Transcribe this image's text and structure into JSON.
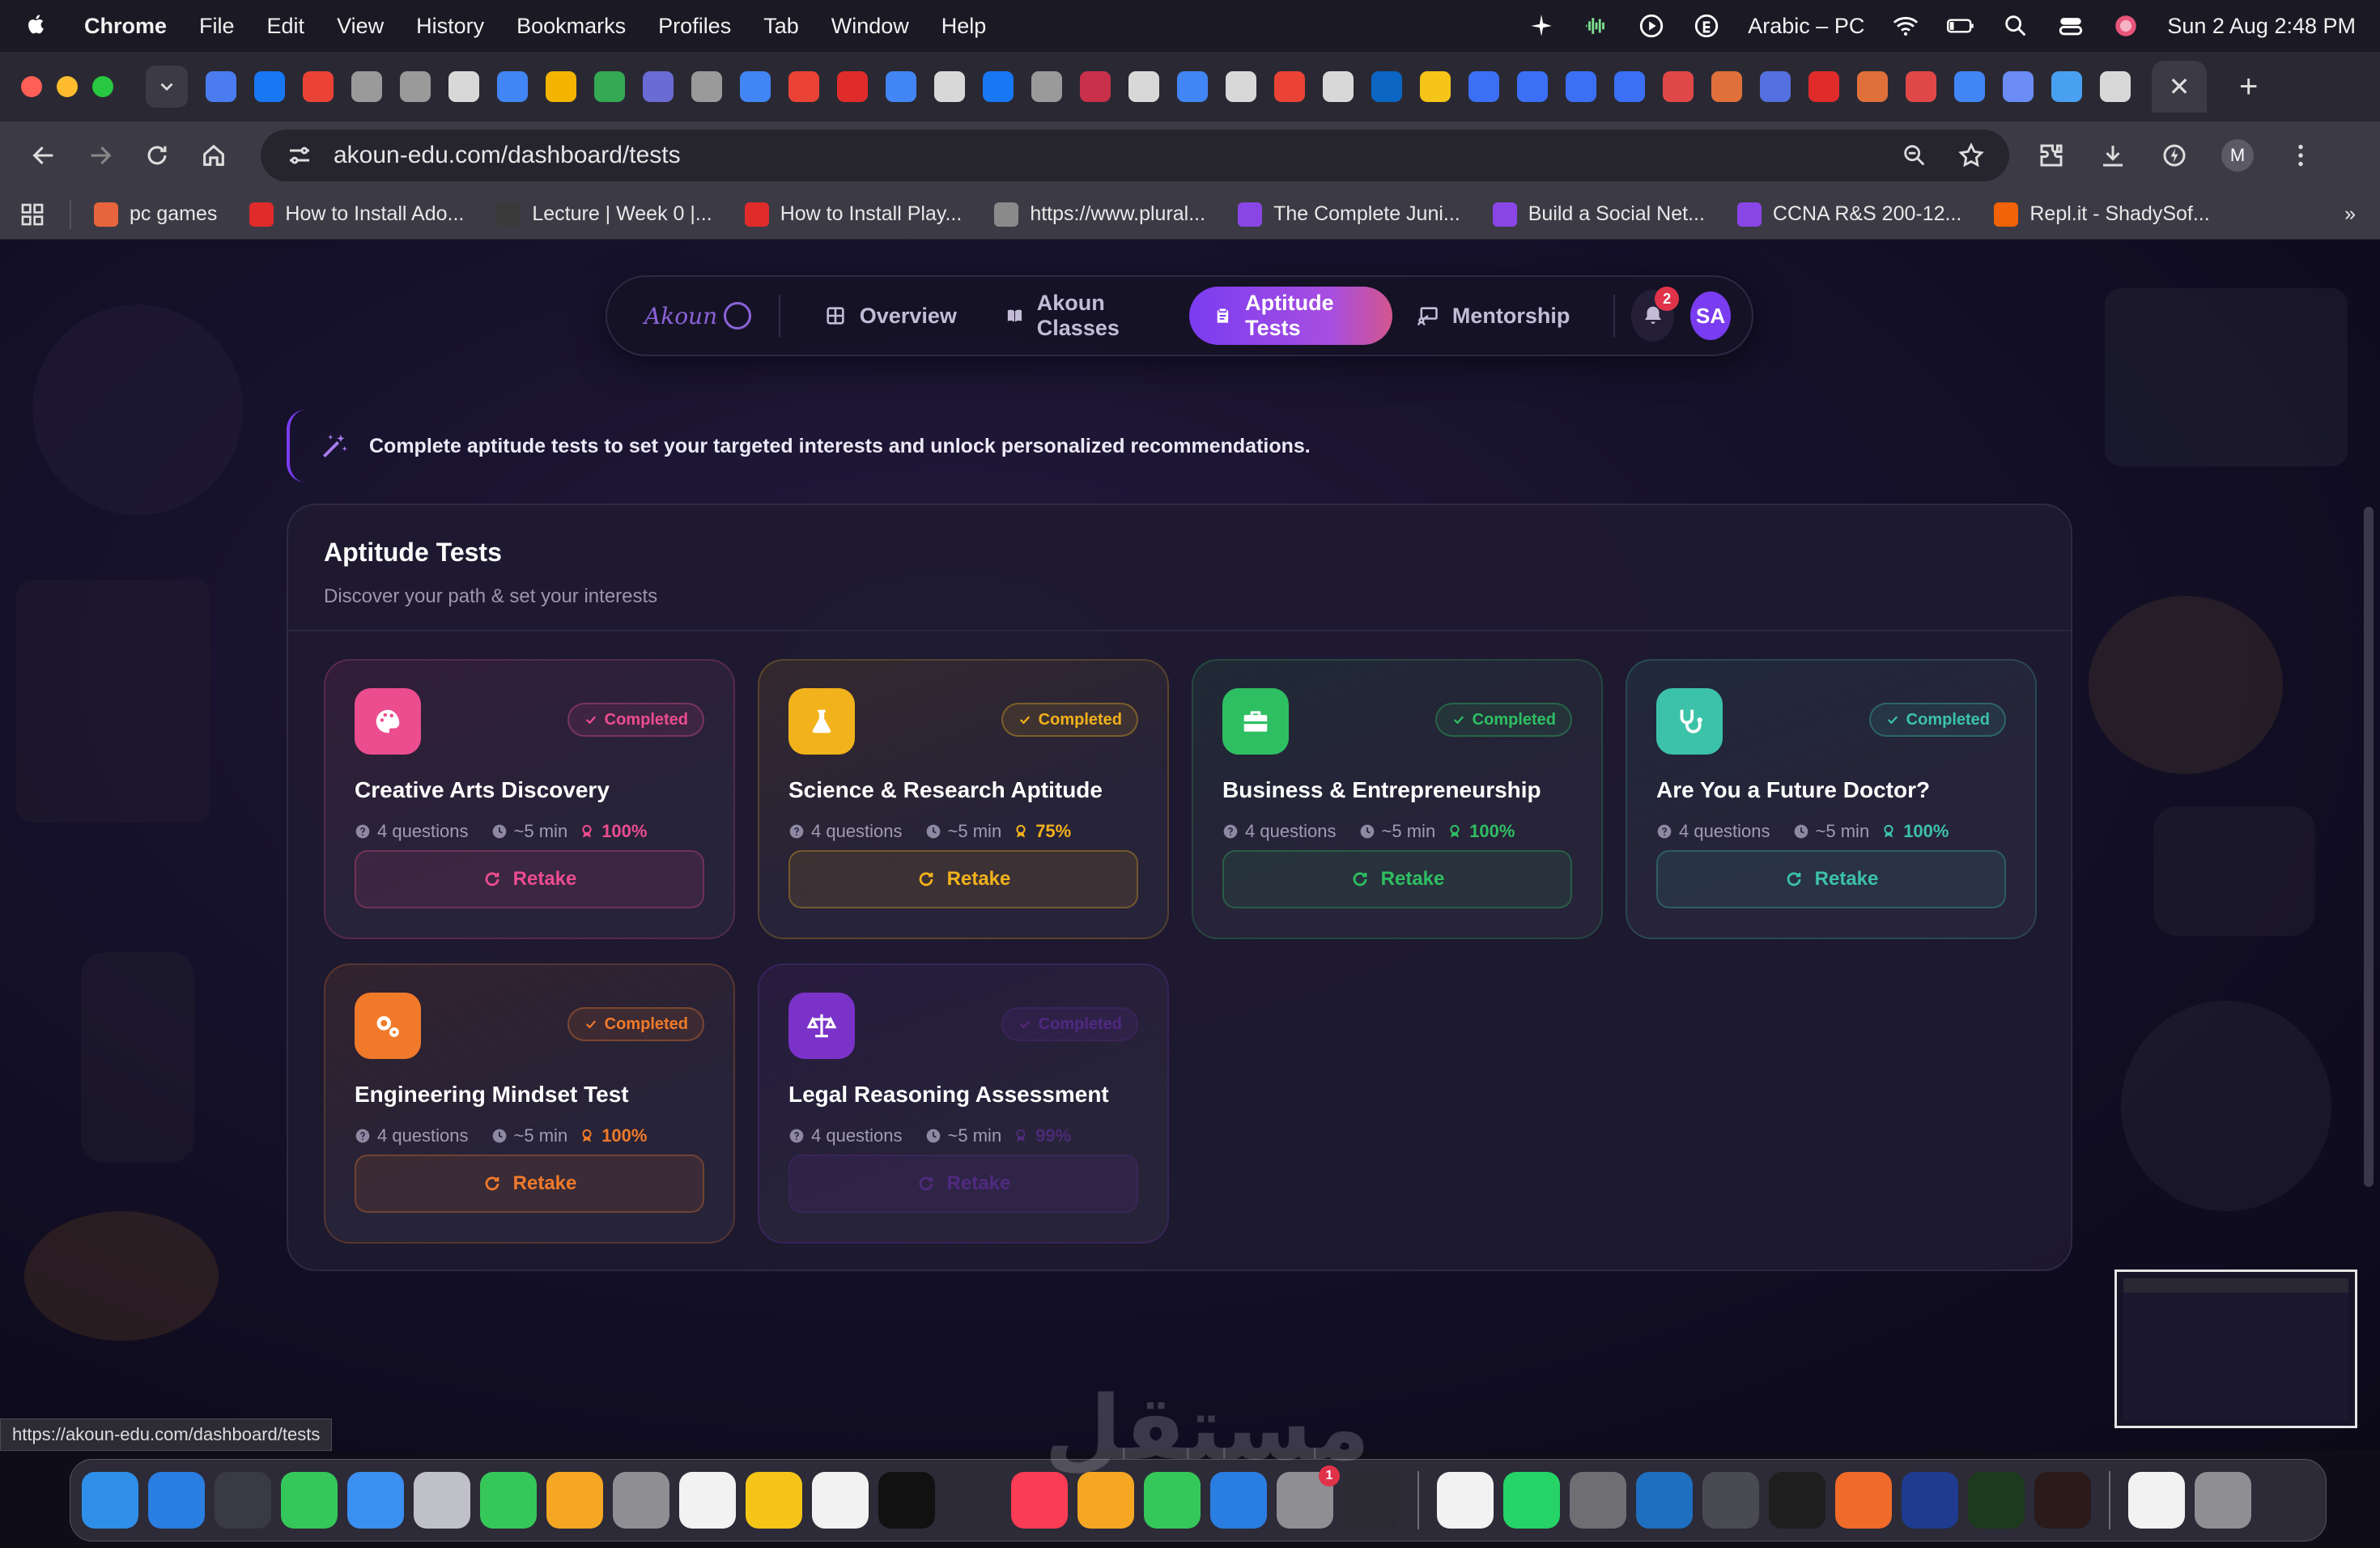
{
  "menubar": {
    "app": "Chrome",
    "items": [
      "File",
      "Edit",
      "View",
      "History",
      "Bookmarks",
      "Profiles",
      "Tab",
      "Window",
      "Help"
    ],
    "input_source": "Arabic – PC",
    "datetime": "Sun 2 Aug  2:48 PM"
  },
  "browser": {
    "url": "akoun-edu.com/dashboard/tests",
    "profile_initial": "M",
    "bookmarks": [
      {
        "label": "pc games",
        "color": "#e8643c"
      },
      {
        "label": "How to Install Ado...",
        "color": "#e02b2b"
      },
      {
        "label": "Lecture | Week 0 |...",
        "color": "#3a3a3a"
      },
      {
        "label": "How to Install Play...",
        "color": "#e02b2b"
      },
      {
        "label": "https://www.plural...",
        "color": "#8a8a8a"
      },
      {
        "label": "The Complete Juni...",
        "color": "#8a45e6"
      },
      {
        "label": "Build a Social Net...",
        "color": "#8a45e6"
      },
      {
        "label": "CCNA R&S 200-12...",
        "color": "#8a45e6"
      },
      {
        "label": "Repl.it - ShadySof...",
        "color": "#f26207"
      }
    ],
    "status_url": "https://akoun-edu.com/dashboard/tests"
  },
  "nav": {
    "logo": "Akoun",
    "items": [
      {
        "label": "Overview",
        "icon": "grid-icon",
        "active": false
      },
      {
        "label": "Akoun Classes",
        "icon": "book-icon",
        "active": false
      },
      {
        "label": "Aptitude Tests",
        "icon": "clipboard-icon",
        "active": true
      },
      {
        "label": "Mentorship",
        "icon": "presentation-icon",
        "active": false
      }
    ],
    "notifications": "2",
    "avatar": "SA"
  },
  "banner": {
    "text": "Complete aptitude tests to set your targeted interests and unlock personalized recommendations."
  },
  "panel": {
    "title": "Aptitude Tests",
    "subtitle": "Discover your path & set your interests"
  },
  "tests": [
    {
      "title": "Creative Arts Discovery",
      "status": "Completed",
      "questions": "4 questions",
      "duration": "~5 min",
      "score": "100%",
      "action": "Retake",
      "icon": "palette-icon",
      "color": "#ec4d8f",
      "dim": false
    },
    {
      "title": "Science & Research Aptitude",
      "status": "Completed",
      "questions": "4 questions",
      "duration": "~5 min",
      "score": "75%",
      "action": "Retake",
      "icon": "flask-icon",
      "color": "#f2b21c",
      "dim": false
    },
    {
      "title": "Business & Entrepreneurship",
      "status": "Completed",
      "questions": "4 questions",
      "duration": "~5 min",
      "score": "100%",
      "action": "Retake",
      "icon": "briefcase-icon",
      "color": "#2fbf63",
      "dim": false
    },
    {
      "title": "Are You a Future Doctor?",
      "status": "Completed",
      "questions": "4 questions",
      "duration": "~5 min",
      "score": "100%",
      "action": "Retake",
      "icon": "stethoscope-icon",
      "color": "#3cc2a8",
      "dim": false
    },
    {
      "title": "Engineering Mindset Test",
      "status": "Completed",
      "questions": "4 questions",
      "duration": "~5 min",
      "score": "100%",
      "action": "Retake",
      "icon": "gears-icon",
      "color": "#f07a2a",
      "dim": false
    },
    {
      "title": "Legal Reasoning Assessment",
      "status": "Completed",
      "questions": "4 questions",
      "duration": "~5 min",
      "score": "99%",
      "action": "Retake",
      "icon": "scales-icon",
      "color": "#7a32c8",
      "dim": true
    }
  ],
  "watermark": "مستقل"
}
